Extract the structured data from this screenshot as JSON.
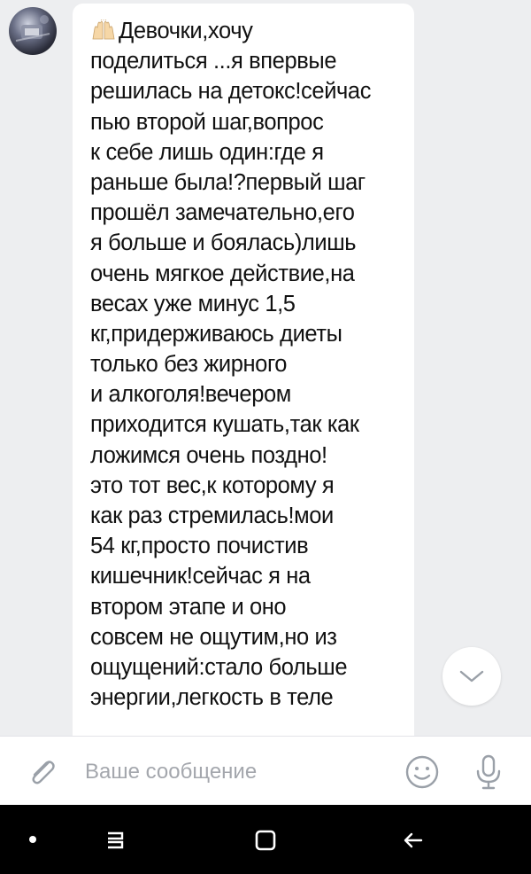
{
  "message": {
    "lines": [
      "Девочки,хочу",
      "поделиться ...я впервые",
      "решилась на детокс!сейчас",
      "пью второй шаг,вопрос",
      "к себе лишь один:где я",
      "раньше была!?первый шаг",
      "прошёл замечательно,его",
      "я больше и боялась)лишь",
      "очень мягкое действие,на",
      "весах  уже минус 1,5",
      "кг,придерживаюсь диеты",
      "только без жирного",
      "и алкоголя!вечером",
      "приходится кушать,так как",
      "ложимся очень поздно!",
      "это тот вес,к которому я",
      "как раз стремилась!мои",
      "54 кг,просто почистив",
      "кишечник!сейчас я на",
      "втором этапе и оно",
      "совсем не ощутим,но из",
      "ощущений:стало больше",
      "энергии,легкость в теле"
    ]
  },
  "composer": {
    "placeholder": "Ваше сообщение"
  },
  "icons": {
    "avatar": "avatar",
    "scroll_down": "chevron-down-icon",
    "attach": "paperclip-icon",
    "emoji": "smile-icon",
    "mic": "microphone-icon",
    "nav_menu": "recent-apps-icon",
    "nav_home": "home-icon",
    "nav_back": "back-icon"
  },
  "colors": {
    "background": "#edeef0",
    "bubble": "#ffffff",
    "icon": "#9aa0a8",
    "navbar": "#000000"
  }
}
